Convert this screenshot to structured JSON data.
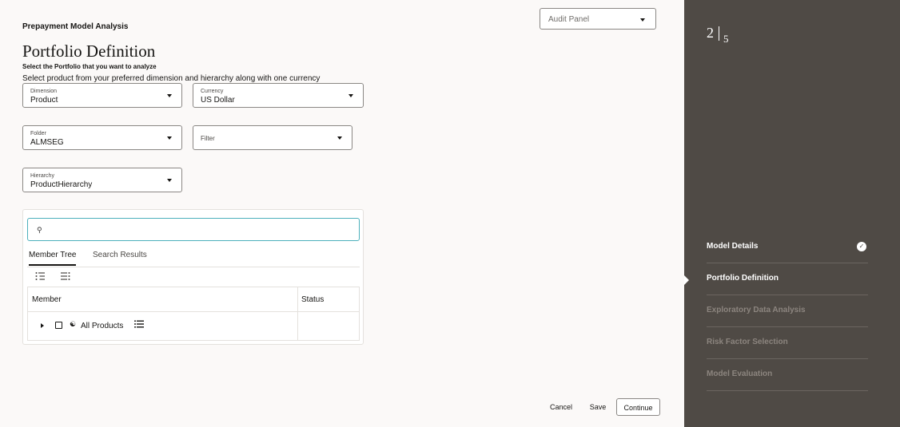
{
  "header": {
    "app_title": "Prepayment Model Analysis",
    "audit_panel": "Audit Panel"
  },
  "page": {
    "title": "Portfolio Definition",
    "subtitle": "Select the Portfolio that you want to analyze",
    "instruction": "Select product from your preferred dimension and hierarchy along with one currency"
  },
  "fields": {
    "dimension": {
      "label": "Dimension",
      "value": "Product"
    },
    "currency": {
      "label": "Currency",
      "value": "US Dollar"
    },
    "folder": {
      "label": "Folder",
      "value": "ALMSEG"
    },
    "filter": {
      "placeholder": "Filter"
    },
    "hierarchy": {
      "label": "Hierarchy",
      "value": "ProductHierarchy"
    }
  },
  "tree_panel": {
    "search_icon": "search-icon",
    "tabs": [
      "Member Tree",
      "Search Results"
    ],
    "tools": [
      "expand-all-icon",
      "collapse-all-icon"
    ],
    "columns": [
      "Member",
      "Status"
    ],
    "rows": [
      {
        "member": "All Products",
        "status": ""
      }
    ]
  },
  "actions": {
    "cancel": "Cancel",
    "save": "Save",
    "continue": "Continue"
  },
  "sidebar": {
    "current_step": "2",
    "total_steps": "5",
    "steps": [
      {
        "label": "Model Details",
        "state": "done"
      },
      {
        "label": "Portfolio Definition",
        "state": "current"
      },
      {
        "label": "Exploratory Data Analysis",
        "state": "future"
      },
      {
        "label": "Risk Factor Selection",
        "state": "future"
      },
      {
        "label": "Model Evaluation",
        "state": "future"
      }
    ]
  },
  "colors": {
    "sidebar_bg": "#4f4a45",
    "search_focus": "#4cb0bc",
    "page_bg": "#fbf9f8"
  }
}
